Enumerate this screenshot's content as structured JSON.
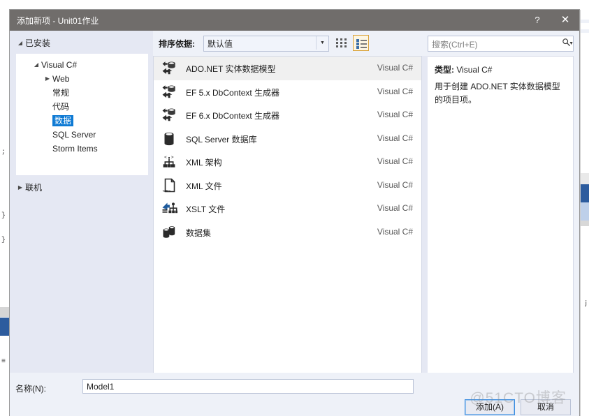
{
  "window": {
    "title": "添加新项 - Unit01作业",
    "help_label": "?",
    "close_label": "✕"
  },
  "tree": {
    "installed_label": "已安装",
    "online_label": "联机",
    "root": "Visual C#",
    "items": [
      {
        "label": "Web",
        "expandable": true
      },
      {
        "label": "常规",
        "expandable": false
      },
      {
        "label": "代码",
        "expandable": false
      },
      {
        "label": "数据",
        "expandable": false,
        "selected": true
      },
      {
        "label": "SQL Server",
        "expandable": false
      },
      {
        "label": "Storm Items",
        "expandable": false
      }
    ],
    "expander_collapsed": "▶",
    "expander_expanded": "◢"
  },
  "toolbar": {
    "sort_label": "排序依据:",
    "sort_value": "默认值",
    "dropdown_arrow": "▼",
    "grid_view_name": "grid-view-icon",
    "list_view_name": "list-view-icon"
  },
  "search": {
    "placeholder": "搜索(Ctrl+E)",
    "icon": "🔍",
    "caret": "▼"
  },
  "list": {
    "items": [
      {
        "name": "ADO.NET 实体数据模型",
        "lang": "Visual C#",
        "icon": "ado-net-model-icon",
        "selected": true
      },
      {
        "name": "EF 5.x DbContext 生成器",
        "lang": "Visual C#",
        "icon": "ado-net-model-icon",
        "selected": false
      },
      {
        "name": "EF 6.x DbContext 生成器",
        "lang": "Visual C#",
        "icon": "ado-net-model-icon",
        "selected": false
      },
      {
        "name": "SQL Server 数据库",
        "lang": "Visual C#",
        "icon": "database-icon",
        "selected": false
      },
      {
        "name": "XML 架构",
        "lang": "Visual C#",
        "icon": "xml-schema-icon",
        "selected": false
      },
      {
        "name": "XML 文件",
        "lang": "Visual C#",
        "icon": "xml-file-icon",
        "selected": false
      },
      {
        "name": "XSLT 文件",
        "lang": "Visual C#",
        "icon": "xslt-file-icon",
        "selected": false
      },
      {
        "name": "数据集",
        "lang": "Visual C#",
        "icon": "dataset-icon",
        "selected": false
      }
    ]
  },
  "details": {
    "type_label": "类型:",
    "type_value": "Visual C#",
    "description": "用于创建 ADO.NET 实体数据模型的项目项。"
  },
  "footer": {
    "name_label": "名称(N):",
    "name_value": "Model1",
    "add_label": "添加(A)",
    "cancel_label": "取消"
  },
  "watermark": {
    "text": "@51CTO博客"
  }
}
